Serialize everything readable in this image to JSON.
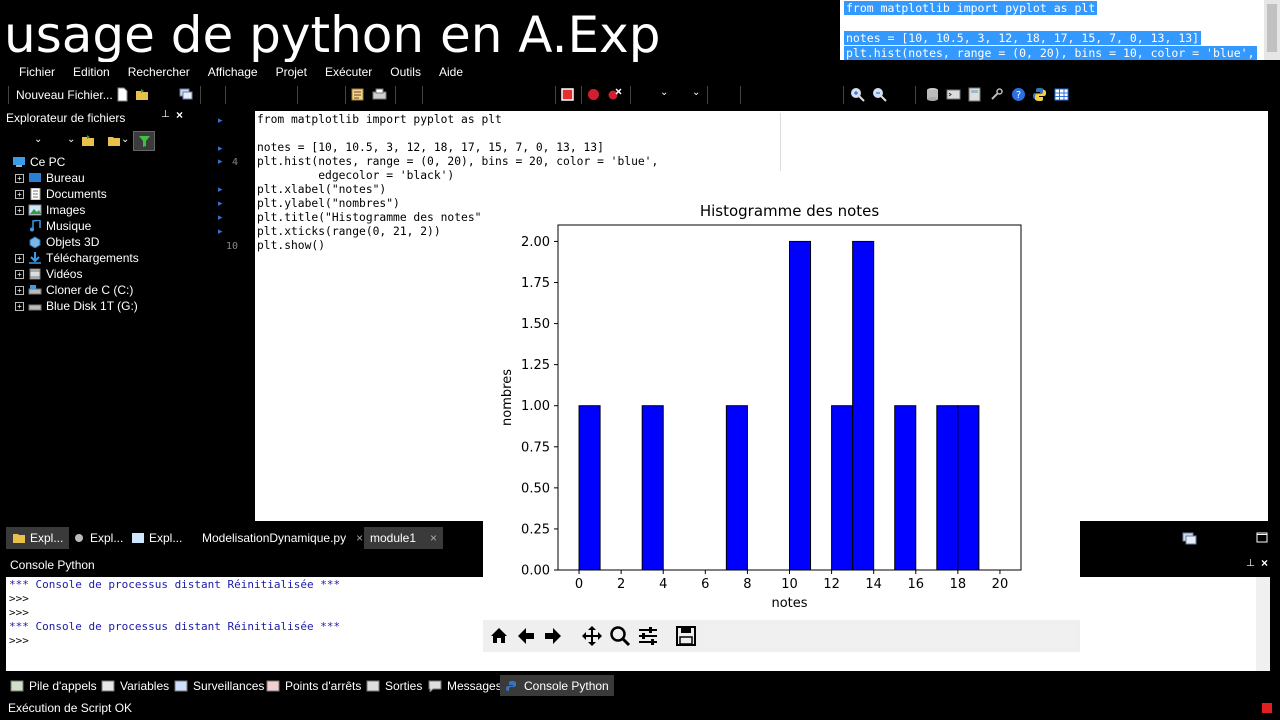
{
  "banner": {
    "title": "usage de python en A.Exp"
  },
  "preview": {
    "lines": [
      "from matplotlib import pyplot as plt",
      "",
      "notes = [10, 10.5, 3, 12, 18, 17, 15, 7, 0, 13, 13]",
      "plt.hist(notes, range = (0, 20), bins = 10, color = 'blue',"
    ]
  },
  "menubar": [
    "Fichier",
    "Edition",
    "Rechercher",
    "Affichage",
    "Projet",
    "Exécuter",
    "Outils",
    "Aide"
  ],
  "toolbar": {
    "new_file": "Nouveau Fichier..."
  },
  "explorer": {
    "title": "Explorateur de fichiers",
    "root": "Ce PC",
    "items": [
      "Bureau",
      "Documents",
      "Images",
      "Musique",
      "Objets 3D",
      "Téléchargements",
      "Vidéos",
      "Cloner de C (C:)",
      "Blue Disk 1T (G:)"
    ]
  },
  "editor": {
    "line_numbers": [
      "4",
      "10"
    ],
    "code": [
      "from matplotlib import pyplot as plt",
      "",
      "notes = [10, 10.5, 3, 12, 18, 17, 15, 7, 0, 13, 13]",
      "plt.hist(notes, range = (0, 20), bins = 20, color = 'blue',",
      "         edgecolor = 'black')",
      "plt.xlabel(\"notes\")",
      "plt.ylabel(\"nombres\")",
      "plt.title(\"Histogramme des notes\")",
      "plt.xticks(range(0, 21, 2))",
      "plt.show()"
    ]
  },
  "left_tabs": [
    "Expl...",
    "Expl...",
    "Expl..."
  ],
  "editor_tabs": [
    "ModelisationDynamique.py",
    "module1"
  ],
  "console": {
    "title": "Console Python",
    "lines": [
      "*** Console de processus distant Réinitialisée ***",
      ">>>",
      ">>>",
      "*** Console de processus distant Réinitialisée ***",
      ">>>"
    ]
  },
  "bottom_tabs": [
    "Pile d'appels",
    "Variables",
    "Surveillances",
    "Points d'arrêts",
    "Sorties",
    "Messages",
    "Console Python"
  ],
  "status": {
    "text": "Exécution de Script OK"
  },
  "colors": {
    "bar_fill": "#0000ff",
    "bar_edge": "#000000",
    "selection": "#3399ff"
  },
  "chart_data": {
    "type": "bar",
    "title": "Histogramme des notes",
    "xlabel": "notes",
    "ylabel": "nombres",
    "xlim": [
      -1,
      21
    ],
    "ylim": [
      0,
      2.1
    ],
    "xticks": [
      0,
      2,
      4,
      6,
      8,
      10,
      12,
      14,
      16,
      18,
      20
    ],
    "yticks": [
      "0.00",
      "0.25",
      "0.50",
      "0.75",
      "1.00",
      "1.25",
      "1.50",
      "1.75",
      "2.00"
    ],
    "bins": [
      {
        "x0": 0,
        "x1": 1,
        "value": 1
      },
      {
        "x0": 3,
        "x1": 4,
        "value": 1
      },
      {
        "x0": 7,
        "x1": 8,
        "value": 1
      },
      {
        "x0": 10,
        "x1": 11,
        "value": 2
      },
      {
        "x0": 12,
        "x1": 13,
        "value": 1
      },
      {
        "x0": 13,
        "x1": 14,
        "value": 2
      },
      {
        "x0": 15,
        "x1": 16,
        "value": 1
      },
      {
        "x0": 17,
        "x1": 18,
        "value": 1
      },
      {
        "x0": 18,
        "x1": 19,
        "value": 1
      }
    ]
  }
}
